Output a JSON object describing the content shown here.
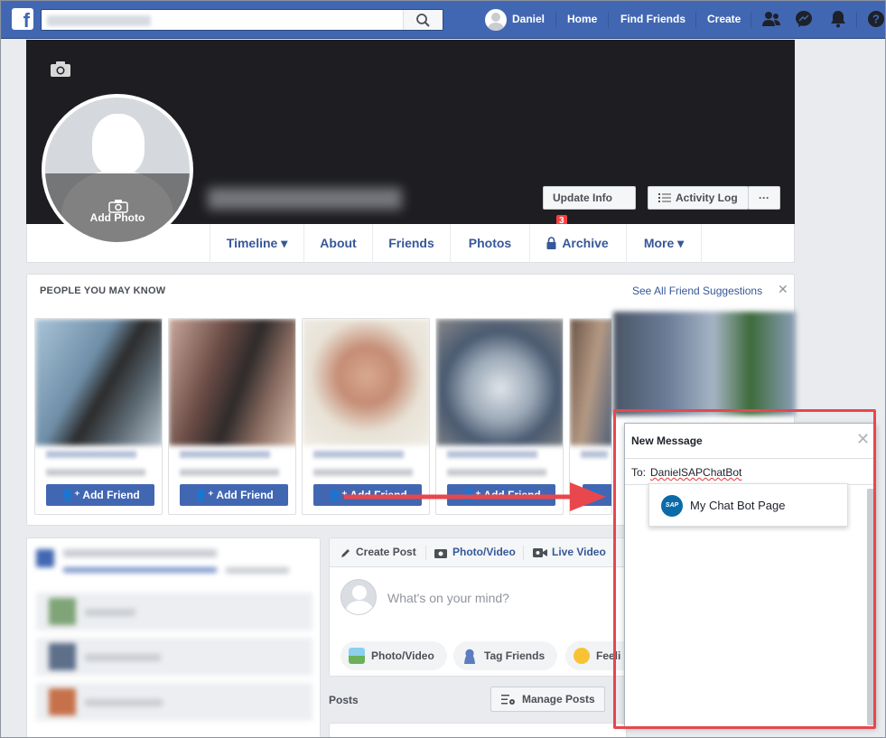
{
  "topbar": {
    "logo": "f",
    "profile_name": "Daniel",
    "nav": [
      "Home",
      "Find Friends",
      "Create"
    ],
    "icons": [
      "friend-requests-icon",
      "messenger-icon",
      "notifications-icon",
      "help-icon"
    ]
  },
  "cover": {
    "add_photo_label": "Add Photo",
    "update_info_label": "Update Info",
    "update_info_count": "3",
    "activity_log_label": "Activity Log",
    "more_label": "···"
  },
  "tabs": [
    "Timeline ▾",
    "About",
    "Friends",
    "Photos",
    "Archive",
    "More ▾"
  ],
  "pymk": {
    "title": "PEOPLE YOU MAY KNOW",
    "see_all": "See All Friend Suggestions",
    "add_friend_label": "Add Friend",
    "add_friend_partial": "Ad"
  },
  "composer": {
    "tabs": [
      "Create Post",
      "Photo/Video",
      "Live Video"
    ],
    "placeholder": "What's on your mind?",
    "actions": [
      "Photo/Video",
      "Tag Friends",
      "Feeli"
    ]
  },
  "posts": {
    "label": "Posts",
    "manage_label": "Manage Posts"
  },
  "new_message": {
    "title": "New Message",
    "to_label": "To:",
    "to_value": "DanielSAPChatBot",
    "suggestion": "My Chat Bot Page",
    "suggestion_logo": "SAP"
  },
  "colors": {
    "brand": "#4267b2",
    "highlight": "#e8474d",
    "link": "#365899"
  }
}
